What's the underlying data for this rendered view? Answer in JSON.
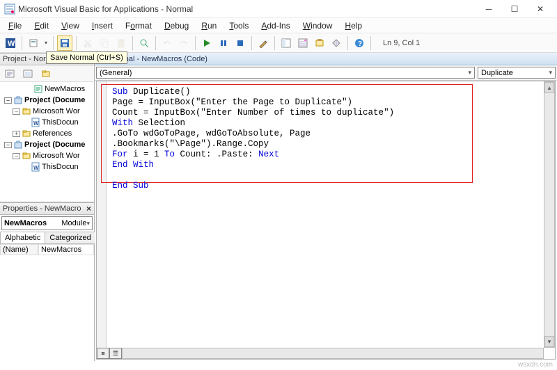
{
  "title": "Microsoft Visual Basic for Applications - Normal",
  "menu": [
    "File",
    "Edit",
    "View",
    "Insert",
    "Format",
    "Debug",
    "Run",
    "Tools",
    "Add-Ins",
    "Window",
    "Help"
  ],
  "tooltip": "Save Normal (Ctrl+S)",
  "cursor_location": "Ln 9, Col 1",
  "project_panel_title": "Project - Norm",
  "tree": {
    "newmacros": "NewMacros",
    "proj1": "Project (Docume",
    "word1": "Microsoft Wor",
    "thisdoc1": "ThisDocun",
    "refs": "References",
    "proj2": "Project (Docume",
    "word2": "Microsoft Wor",
    "thisdoc2": "ThisDocun"
  },
  "properties_panel_title": "Properties - NewMacro",
  "prop_object_name": "NewMacros",
  "prop_object_type": "Module",
  "tab_alpha": "Alphabetic",
  "tab_cat": "Categorized",
  "prop_name_label": "(Name)",
  "prop_name_value": "NewMacros",
  "mdi_title": "Normal - NewMacros (Code)",
  "combo_left": "(General)",
  "combo_right": "Duplicate",
  "code": {
    "l1a": "Sub",
    "l1b": " Duplicate()",
    "l2": "Page = InputBox(\"Enter the Page to Duplicate\")",
    "l3": "Count = InputBox(\"Enter Number of times to duplicate\")",
    "l4a": "With",
    "l4b": " Selection",
    "l5": ".GoTo wdGoToPage, wdGoToAbsolute, Page",
    "l6": ".Bookmarks(\"\\Page\").Range.Copy",
    "l7a": "For",
    "l7b": " i = 1 ",
    "l7c": "To",
    "l7d": " Count: .Paste: ",
    "l7e": "Next",
    "l8": "End With",
    "l9": "End Sub"
  },
  "watermark": "wsxdn.com"
}
